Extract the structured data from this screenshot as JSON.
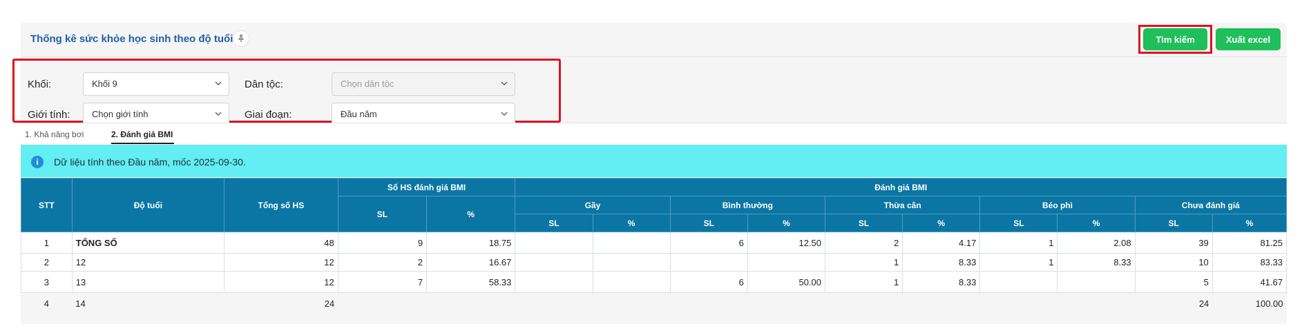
{
  "header": {
    "title": "Thống kê sức khỏe học sinh theo độ tuổi",
    "search_button": "Tìm kiếm",
    "export_button": "Xuất excel"
  },
  "filters": {
    "khoi": {
      "label": "Khối:",
      "value": "Khối 9"
    },
    "dantoc": {
      "label": "Dân tộc:",
      "placeholder": "Chọn dân tộc"
    },
    "gioitinh": {
      "label": "Giới tính:",
      "placeholder": "Chọn giới tính"
    },
    "giaidoan": {
      "label": "Giai đoạn:",
      "value": "Đầu năm"
    }
  },
  "tabs": [
    {
      "label": "1. Khả năng bơi"
    },
    {
      "label": "2. Đánh giá BMI"
    }
  ],
  "info": {
    "text": "Dữ liệu tính theo Đầu năm, mốc 2025-09-30."
  },
  "table": {
    "headers": {
      "stt": "STT",
      "dotuoi": "Độ tuổi",
      "tongso": "Tổng số HS",
      "sohs": "Số HS đánh giá BMI",
      "danhgia": "Đánh giá BMI",
      "gay": "Gầy",
      "binhthuong": "Bình thường",
      "thuacan": "Thừa cân",
      "beophi": "Béo phì",
      "chuadanhgia": "Chưa đánh giá",
      "sl": "SL",
      "pct": "%"
    },
    "rows": [
      [
        "1",
        "TỔNG SỐ",
        "48",
        "9",
        "18.75",
        "",
        "",
        "6",
        "12.50",
        "2",
        "4.17",
        "1",
        "2.08",
        "39",
        "81.25"
      ],
      [
        "2",
        "12",
        "12",
        "2",
        "16.67",
        "",
        "",
        "",
        "",
        "1",
        "8.33",
        "1",
        "8.33",
        "10",
        "83.33"
      ],
      [
        "3",
        "13",
        "12",
        "7",
        "58.33",
        "",
        "",
        "6",
        "50.00",
        "1",
        "8.33",
        "",
        "",
        "5",
        "41.67"
      ],
      [
        "4",
        "14",
        "24",
        "",
        "",
        "",
        "",
        "",
        "",
        "",
        "",
        "",
        "",
        "24",
        "100.00"
      ]
    ]
  },
  "colors": {
    "header_bg": "#0b76a4",
    "button": "#1fbf5c",
    "info_bg": "#62eef2",
    "highlight": "#e0101c"
  },
  "icons": {
    "pin": "pin-icon",
    "chevron": "chevron-down-icon",
    "info": "info-icon"
  }
}
